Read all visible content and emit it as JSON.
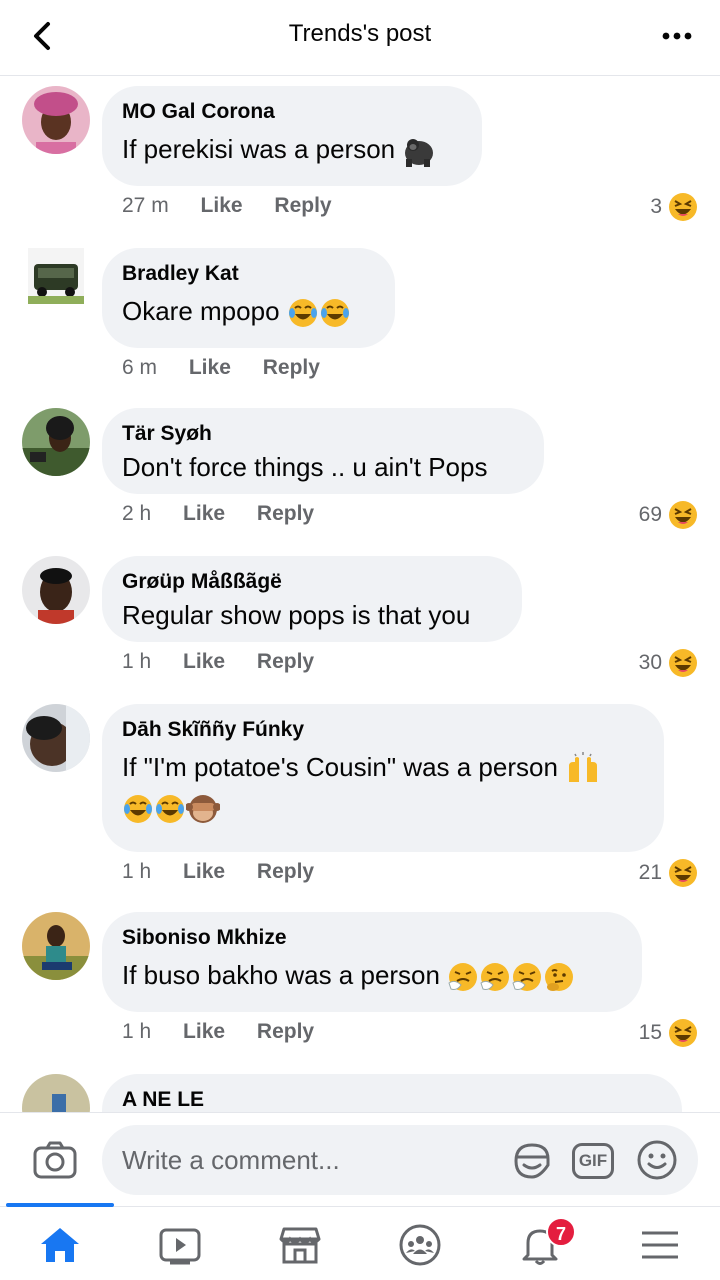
{
  "header": {
    "title": "Trends's post",
    "back_icon": "chevron-left-icon",
    "more_icon": "more-horizontal-icon"
  },
  "colors": {
    "accent": "#1877f2",
    "bubble": "#f0f2f5",
    "meta": "#65676b",
    "badge": "#e41e3f"
  },
  "comments": [
    {
      "author": "MO Gal Corona",
      "text": "If perekisi was a person",
      "emoji": [
        "gorilla"
      ],
      "time": "27 m",
      "like": "Like",
      "reply": "Reply",
      "reactions": "3",
      "reaction_emoji": "laughing"
    },
    {
      "author": "Bradley Kat",
      "text": "Okare mpopo",
      "emoji": [
        "joy",
        "joy"
      ],
      "time": "6 m",
      "like": "Like",
      "reply": "Reply",
      "reactions": "",
      "reaction_emoji": ""
    },
    {
      "author": "Tär Syøh",
      "text": "Don't force things .. u ain't Pops",
      "emoji": [],
      "time": "2 h",
      "like": "Like",
      "reply": "Reply",
      "reactions": "69",
      "reaction_emoji": "laughing"
    },
    {
      "author": "Grøüp Måßßãgë",
      "text": "Regular show pops is that you",
      "emoji": [],
      "time": "1 h",
      "like": "Like",
      "reply": "Reply",
      "reactions": "30",
      "reaction_emoji": "laughing"
    },
    {
      "author": "Dāh Skĩññy Fúnky",
      "text": "If \"I'm potatoe's Cousin\" was a person",
      "emoji": [
        "raised-hands"
      ],
      "text2_emoji": [
        "joy",
        "joy",
        "see-no-evil-monkey"
      ],
      "time": "1 h",
      "like": "Like",
      "reply": "Reply",
      "reactions": "21",
      "reaction_emoji": "laughing"
    },
    {
      "author": "Siboniso Mkhize",
      "text": "If buso bakho was a person",
      "emoji": [
        "sneezing",
        "sneezing",
        "sneezing",
        "thinking"
      ],
      "time": "1 h",
      "like": "Like",
      "reply": "Reply",
      "reactions": "15",
      "reaction_emoji": "laughing"
    },
    {
      "author": "A NE LE"
    }
  ],
  "composer": {
    "placeholder": "Write a comment...",
    "camera_icon": "camera-icon",
    "sticker_icon": "sticker-icon",
    "gif_label": "GIF",
    "emoji_icon": "smiley-icon"
  },
  "tabbar": {
    "tabs": [
      "home-icon",
      "watch-icon",
      "marketplace-icon",
      "groups-icon",
      "notifications-icon",
      "menu-icon"
    ],
    "notification_count": "7",
    "active": "home"
  }
}
